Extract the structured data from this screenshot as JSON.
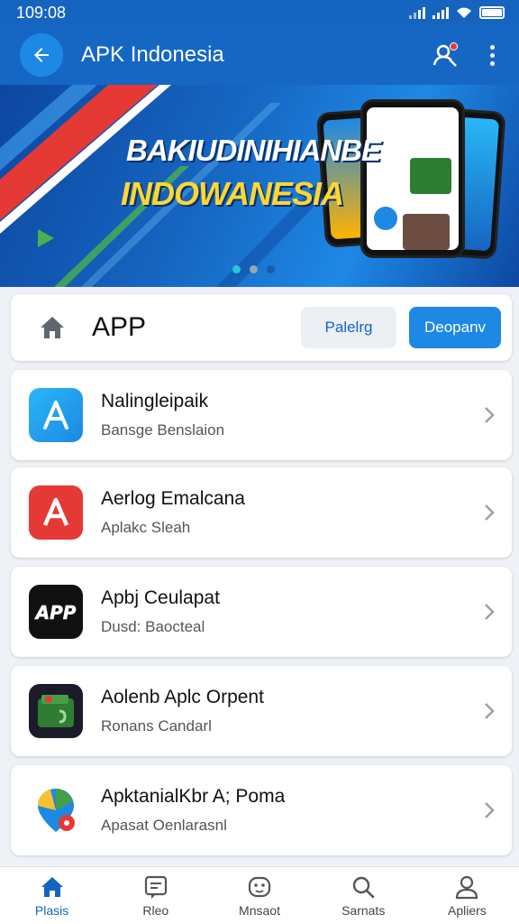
{
  "status_bar": {
    "time": "109:08"
  },
  "app_bar": {
    "title": "APK Indonesia",
    "back_icon": "arrow-left-icon",
    "notify_icon": "user-search-icon",
    "menu_icon": "more-vert-icon"
  },
  "banner": {
    "line1": "BAKIUDINIHIANBE",
    "line2": "INDOWANESIA",
    "active_slide": 1,
    "slide_count": 3
  },
  "header": {
    "title": "APP",
    "home_icon": "home-icon",
    "button_secondary": "Palelrg",
    "button_primary": "Deopanv"
  },
  "apps": [
    {
      "title": "Nalingleipaik",
      "subtitle": "Bansge Benslaion",
      "icon": "a-logo-icon"
    },
    {
      "title": "Aerlog Emalcana",
      "subtitle": "Aplakc Sleah",
      "icon": "a-red-logo-icon"
    },
    {
      "title": "Apbj Ceulapat",
      "subtitle": "Dusd: Baocteal",
      "icon": "app-logo-icon"
    },
    {
      "title": "Aolenb Aplc Orpent",
      "subtitle": "Ronans Candarl",
      "icon": "green-folder-icon"
    },
    {
      "title": "ApktanialKbr A; Poma",
      "subtitle": "Apasat Oenlarasnl",
      "icon": "maps-pin-icon"
    }
  ],
  "bottom_nav": [
    {
      "label": "Plasis",
      "icon": "home-icon",
      "active": true
    },
    {
      "label": "Rleo",
      "icon": "message-icon",
      "active": false
    },
    {
      "label": "Mnsaot",
      "icon": "game-icon",
      "active": false
    },
    {
      "label": "Sarnats",
      "icon": "search-icon",
      "active": false
    },
    {
      "label": "Apliers",
      "icon": "person-icon",
      "active": false
    }
  ],
  "colors": {
    "primary": "#1667c4",
    "accent": "#1e88e5",
    "background": "#eef1f5"
  }
}
